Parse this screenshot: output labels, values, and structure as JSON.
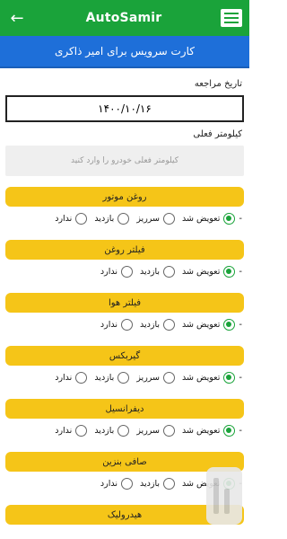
{
  "app": {
    "title": "AutoSamir"
  },
  "icons": {
    "back": "arrow-left-icon",
    "menu": "menu-icon"
  },
  "colors": {
    "topbar": "#1aa33a",
    "header": "#1e6fd9",
    "section": "#f5c518",
    "radio_checked": "#1aa33a"
  },
  "page": {
    "title": "کارت سرویس برای امیر ذاکری"
  },
  "form": {
    "date_label": "تاریخ مراجعه",
    "date_value": "۱۴۰۰/۱۰/۱۶",
    "km_label": "کیلومتر فعلی",
    "km_placeholder": "کیلومتر فعلی خودرو را وارد کنید"
  },
  "sections": [
    {
      "title": "روغن موتور",
      "options": [
        "تعویض شد",
        "سرریز",
        "بازدید",
        "ندارد"
      ],
      "selected": 0
    },
    {
      "title": "فیلتر روغن",
      "options": [
        "تعویض شد",
        "بازدید",
        "ندارد"
      ],
      "selected": 0
    },
    {
      "title": "فیلتر هوا",
      "options": [
        "تعویض شد",
        "بازدید",
        "ندارد"
      ],
      "selected": 0
    },
    {
      "title": "گیربکس",
      "options": [
        "تعویض شد",
        "سرریز",
        "بازدید",
        "ندارد"
      ],
      "selected": 0
    },
    {
      "title": "دیفرانسیل",
      "options": [
        "تعویض شد",
        "سرریز",
        "بازدید",
        "ندارد"
      ],
      "selected": 0
    },
    {
      "title": "صافی بنزین",
      "options": [
        "تعویض شد",
        "بازدید",
        "ندارد"
      ],
      "selected": 0
    },
    {
      "title": "هیدرولیک"
    }
  ],
  "dash": "-"
}
